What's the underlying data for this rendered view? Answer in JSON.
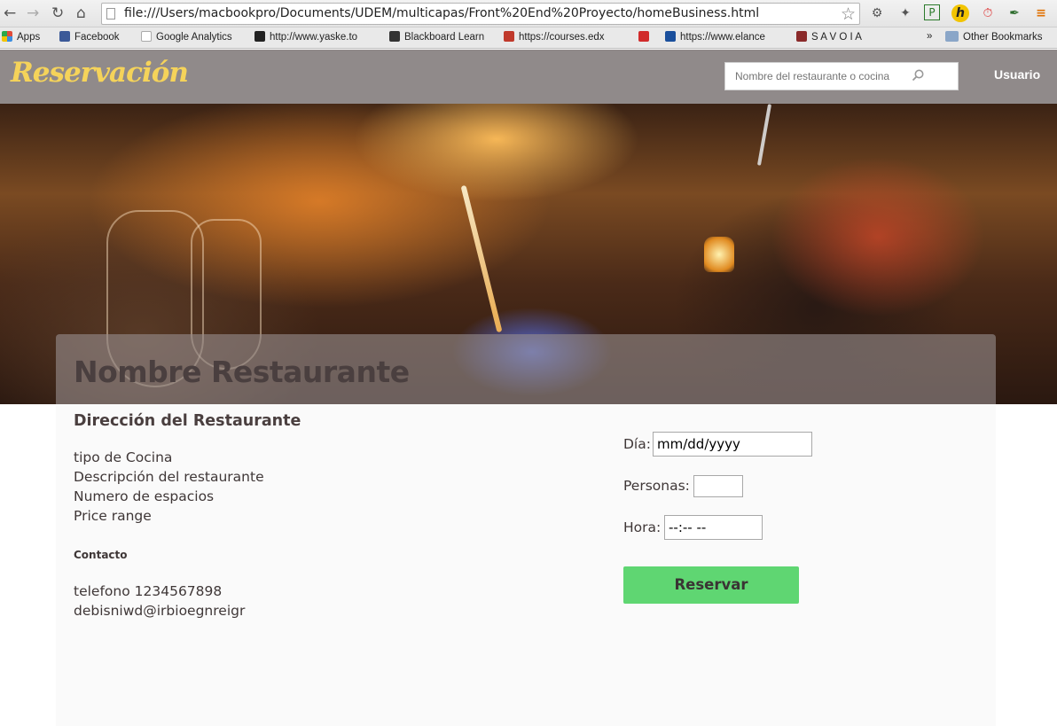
{
  "browser": {
    "url": "file:///Users/macbookpro/Documents/UDEM/multicapas/Front%20End%20Proyecto/homeBusiness.html",
    "bookmarks": [
      {
        "label": "Apps",
        "color": "#e04b3a"
      },
      {
        "label": "Facebook",
        "color": "#3b5998"
      },
      {
        "label": "Google Analytics",
        "color": "#cccccc"
      },
      {
        "label": "http://www.yaske.to",
        "color": "#222222"
      },
      {
        "label": "Blackboard Learn",
        "color": "#333333"
      },
      {
        "label": "https://courses.edx",
        "color": "#c0392b"
      },
      {
        "label": "",
        "color": "#d12b2b"
      },
      {
        "label": "https://www.elance",
        "color": "#1a4f9c"
      },
      {
        "label": "S A V O I A",
        "color": "#8a2a2a"
      }
    ],
    "more_label": "»",
    "other_bookmarks": "Other Bookmarks"
  },
  "site": {
    "logo": "Reservación",
    "search_placeholder": "Nombre del restaurante o cocina",
    "user_label": "Usuario",
    "brand_color": "#f5d35a",
    "header_color": "#908a8a"
  },
  "restaurant": {
    "name": "Nombre Restaurante",
    "address": "Dirección del Restaurante",
    "details": [
      "tipo de Cocina",
      "Descripción del restaurante",
      "Numero de espacios",
      "Price range"
    ],
    "contact_heading": "Contacto",
    "phone": "telefono 1234567898",
    "email": "debisniwd@irbioegnreigr"
  },
  "reservation": {
    "day_label": "Día:",
    "day_value": "mm/dd/yyyy",
    "people_label": "Personas:",
    "people_value": "",
    "time_label": "Hora:",
    "time_value": "--:-- --",
    "submit_label": "Reservar",
    "submit_color": "#5fd672"
  }
}
